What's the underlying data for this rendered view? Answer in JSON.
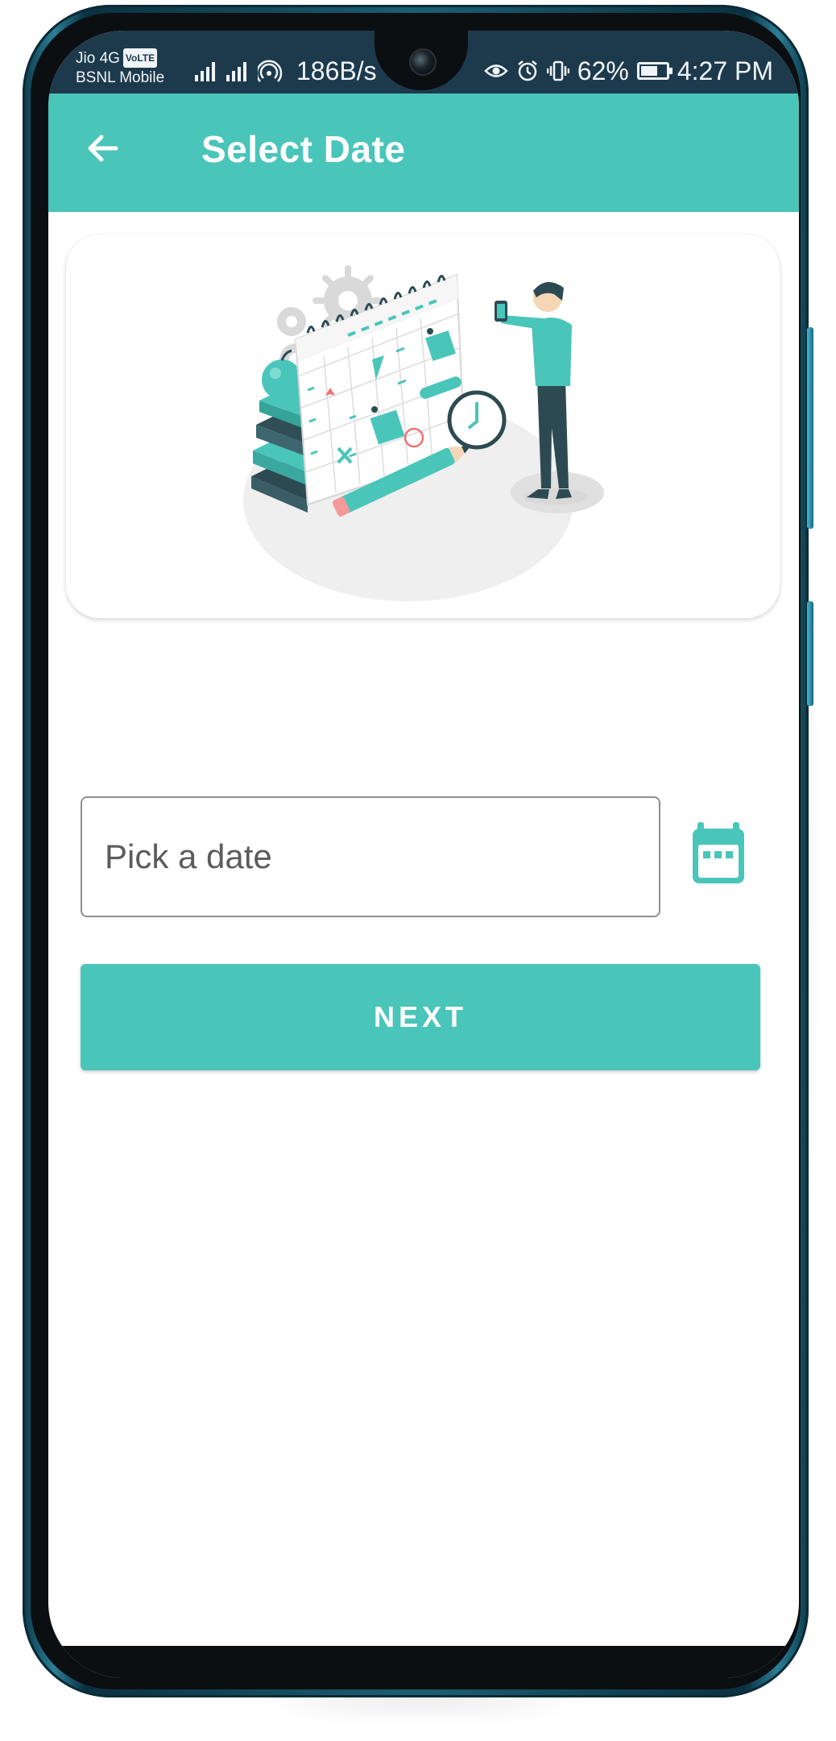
{
  "status_bar": {
    "carrier_line1": "Jio 4G",
    "volte_badge": "VoLTE",
    "carrier_line2": "BSNL Mobile",
    "network_speed": "186B/s",
    "battery_percent": "62%",
    "time": "4:27 PM"
  },
  "app_bar": {
    "title": "Select Date",
    "back_icon": "arrow-back-icon"
  },
  "form": {
    "date_placeholder": "Pick a date",
    "date_value": "",
    "calendar_icon": "calendar-icon",
    "next_label": "NEXT"
  },
  "colors": {
    "accent": "#4AC5BA",
    "status_bar": "#1D3A4D",
    "background": "#FFFFFF",
    "input_border": "#8F8F8F"
  }
}
